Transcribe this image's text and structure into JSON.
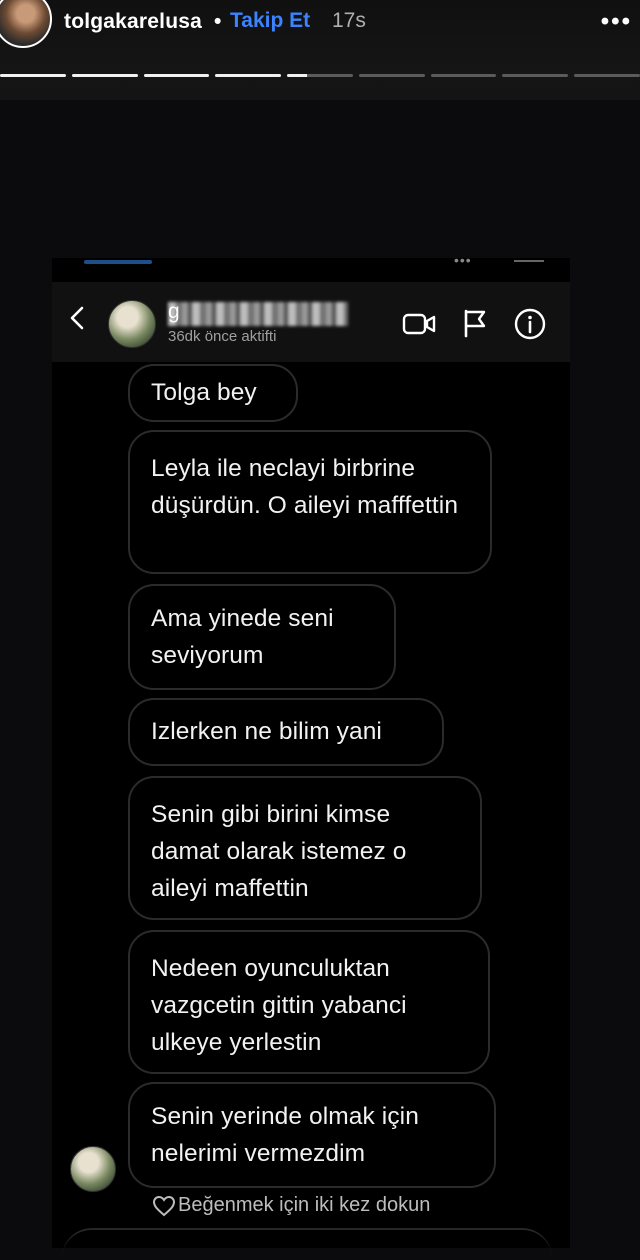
{
  "story_header": {
    "username": "tolgakarelusa",
    "separator": "•",
    "follow_label": "Takip Et",
    "time": "17s",
    "more_label": "•••",
    "progress": {
      "segments_total": 9,
      "segments_viewed": 4,
      "current_segment_fraction": 0.3
    }
  },
  "dm": {
    "name_initial": "g",
    "status": "36dk önce aktifti",
    "messages": [
      {
        "text": "Tolga bey"
      },
      {
        "text": "Leyla ile neclayi birbrine düşürdün.  O aileyi mafffettin"
      },
      {
        "text": "Ama yinede seni seviyorum"
      },
      {
        "text": "Izlerken ne bilim yani"
      },
      {
        "text": "Senin gibi birini kimse damat olarak istemez o aileyi maffettin"
      },
      {
        "text": "Nedeen oyunculuktan vazgcetin gittin yabanci ulkeye yerlestin"
      },
      {
        "text": "Senin yerinde olmak için nelerimi vermezdim"
      }
    ],
    "like_hint": "Beğenmek için iki kez dokun"
  },
  "colors": {
    "follow": "#3b83ff",
    "bubble_border": "#2b2b2b",
    "background": "#0b0b0d"
  }
}
